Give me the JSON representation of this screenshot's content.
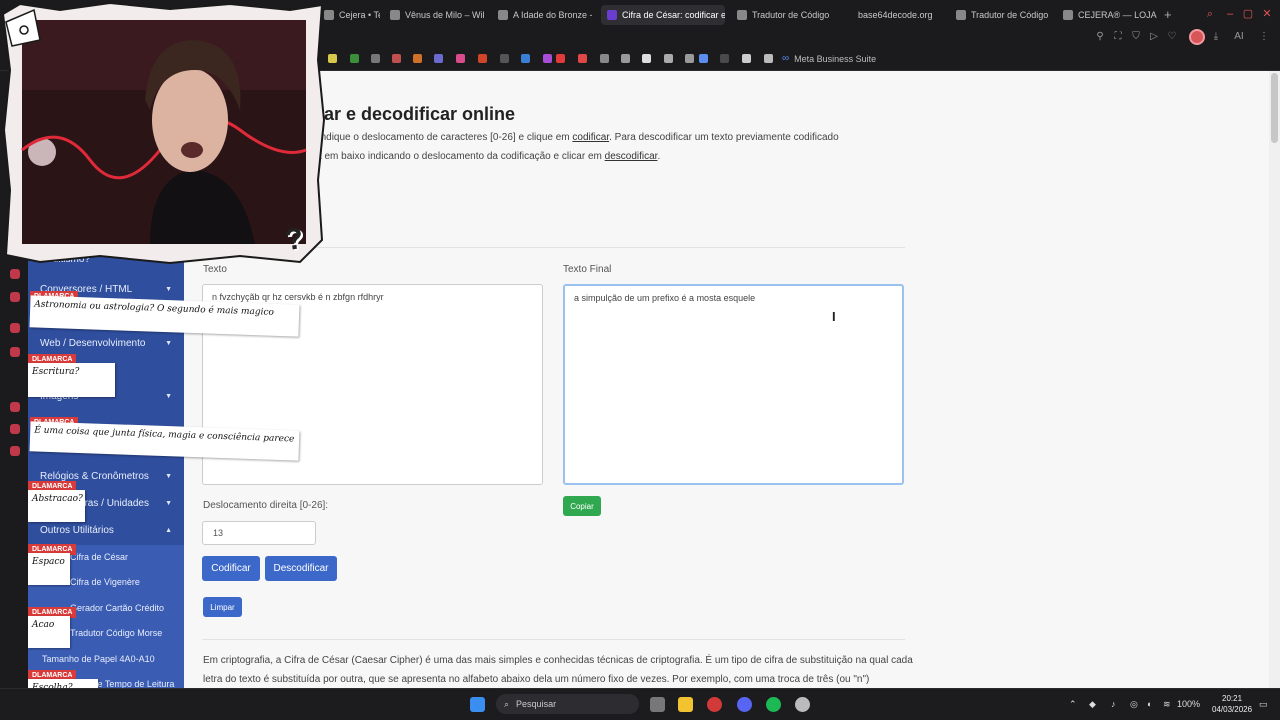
{
  "browser": {
    "tabs": [
      {
        "label": "Cejera • Termi"
      },
      {
        "label": "Vênus de Milo – Wiki"
      },
      {
        "label": "A Idade do Bronze -"
      },
      {
        "label": "Cifra de César: codificar e",
        "active": true
      },
      {
        "label": "Tradutor de Código I"
      },
      {
        "label": "base64decode.org"
      },
      {
        "label": "Tradutor de Código N"
      },
      {
        "label": "CEJERA® — LOJA | S"
      }
    ],
    "new_tab": "+",
    "toolbar_text": "AI",
    "bookmark_meta": "Meta Business Suite"
  },
  "page": {
    "title": ": codificar e decodificar online",
    "intro_line1_a": "rea em baixo, indique o deslocamento de caracteres [0-26] e clique em ",
    "intro_line1_link": "codificar",
    "intro_line1_b": ". Para descodificar um texto previamente codificado",
    "intro_line2_a": "o texto na área em baixo indicando o deslocamento da codificação e clicar em ",
    "intro_line2_link": "descodificar",
    "intro_line2_b": ".",
    "text_label": "Texto",
    "text_value": "n fvzchyçãb qr hz cersvkb é n zbfgn rfdhryr",
    "final_label": "Texto Final",
    "final_value": "a simpulção de um prefixo é a mosta esquele",
    "shift_label": "Deslocamento direita [0-26]:",
    "shift_value": "13",
    "btn_encode": "Codificar",
    "btn_decode": "Descodificar",
    "btn_clear": "Limpar",
    "btn_copy": "Copiar",
    "desc_line1": "Em criptografia, a Cifra de César (Caesar Cipher) é uma das mais simples e conhecidas técnicas de criptografia. É um tipo de cifra de substituição na qual cada",
    "desc_line2": "letra do texto é substituída por outra, que se apresenta no alfabeto abaixo dela um número fixo de vezes. Por exemplo, com uma troca de três (ou \"n\")"
  },
  "sidebar": {
    "items": [
      {
        "label": "Ocultismo?"
      },
      {
        "label": "Conversores / HTML"
      },
      {
        "label": "Web / Desenvolvimento"
      },
      {
        "label": "Imagens"
      },
      {
        "label": "Relógios & Cronômetros"
      },
      {
        "label": "Calculadoras / Unidades"
      },
      {
        "label": "Outros Utilitários"
      }
    ],
    "subitems": [
      {
        "label": "Cifra de César"
      },
      {
        "label": "Cifra de Vigenère"
      },
      {
        "label": "Gerador Cartão Crédito"
      },
      {
        "label": "Tradutor Código Morse"
      },
      {
        "label": "Tamanho de Papel 4A0-A10"
      },
      {
        "label": "Calculadora de Tempo de Leitura"
      }
    ]
  },
  "chat": [
    {
      "user": "DLAMARCA",
      "message": "Astronomia ou astrologia? O segundo é mais magico"
    },
    {
      "user": "DLAMARCA",
      "message": "Escritura?"
    },
    {
      "user": "DLAMARCA",
      "message": "É uma coisa que junta física, magia e consciência parece"
    },
    {
      "user": "DLAMARCA",
      "message": "Abstracao?"
    },
    {
      "user": "DLAMARCA",
      "message": "Espaco"
    },
    {
      "user": "DLAMARCA",
      "message": "Acao"
    },
    {
      "user": "DLAMARCA",
      "message": "Escolha?"
    }
  ],
  "taskbar": {
    "search_placeholder": "Pesquisar",
    "battery": "100%",
    "time": "20:21",
    "date": "04/03/2026"
  },
  "colors": {
    "sidebar": "#2f4e9e",
    "button_blue": "#3c68c9",
    "button_green": "#2fa84f",
    "chat_tag": "#d93a3a",
    "active_tab_icon": "#6a3ccf"
  }
}
